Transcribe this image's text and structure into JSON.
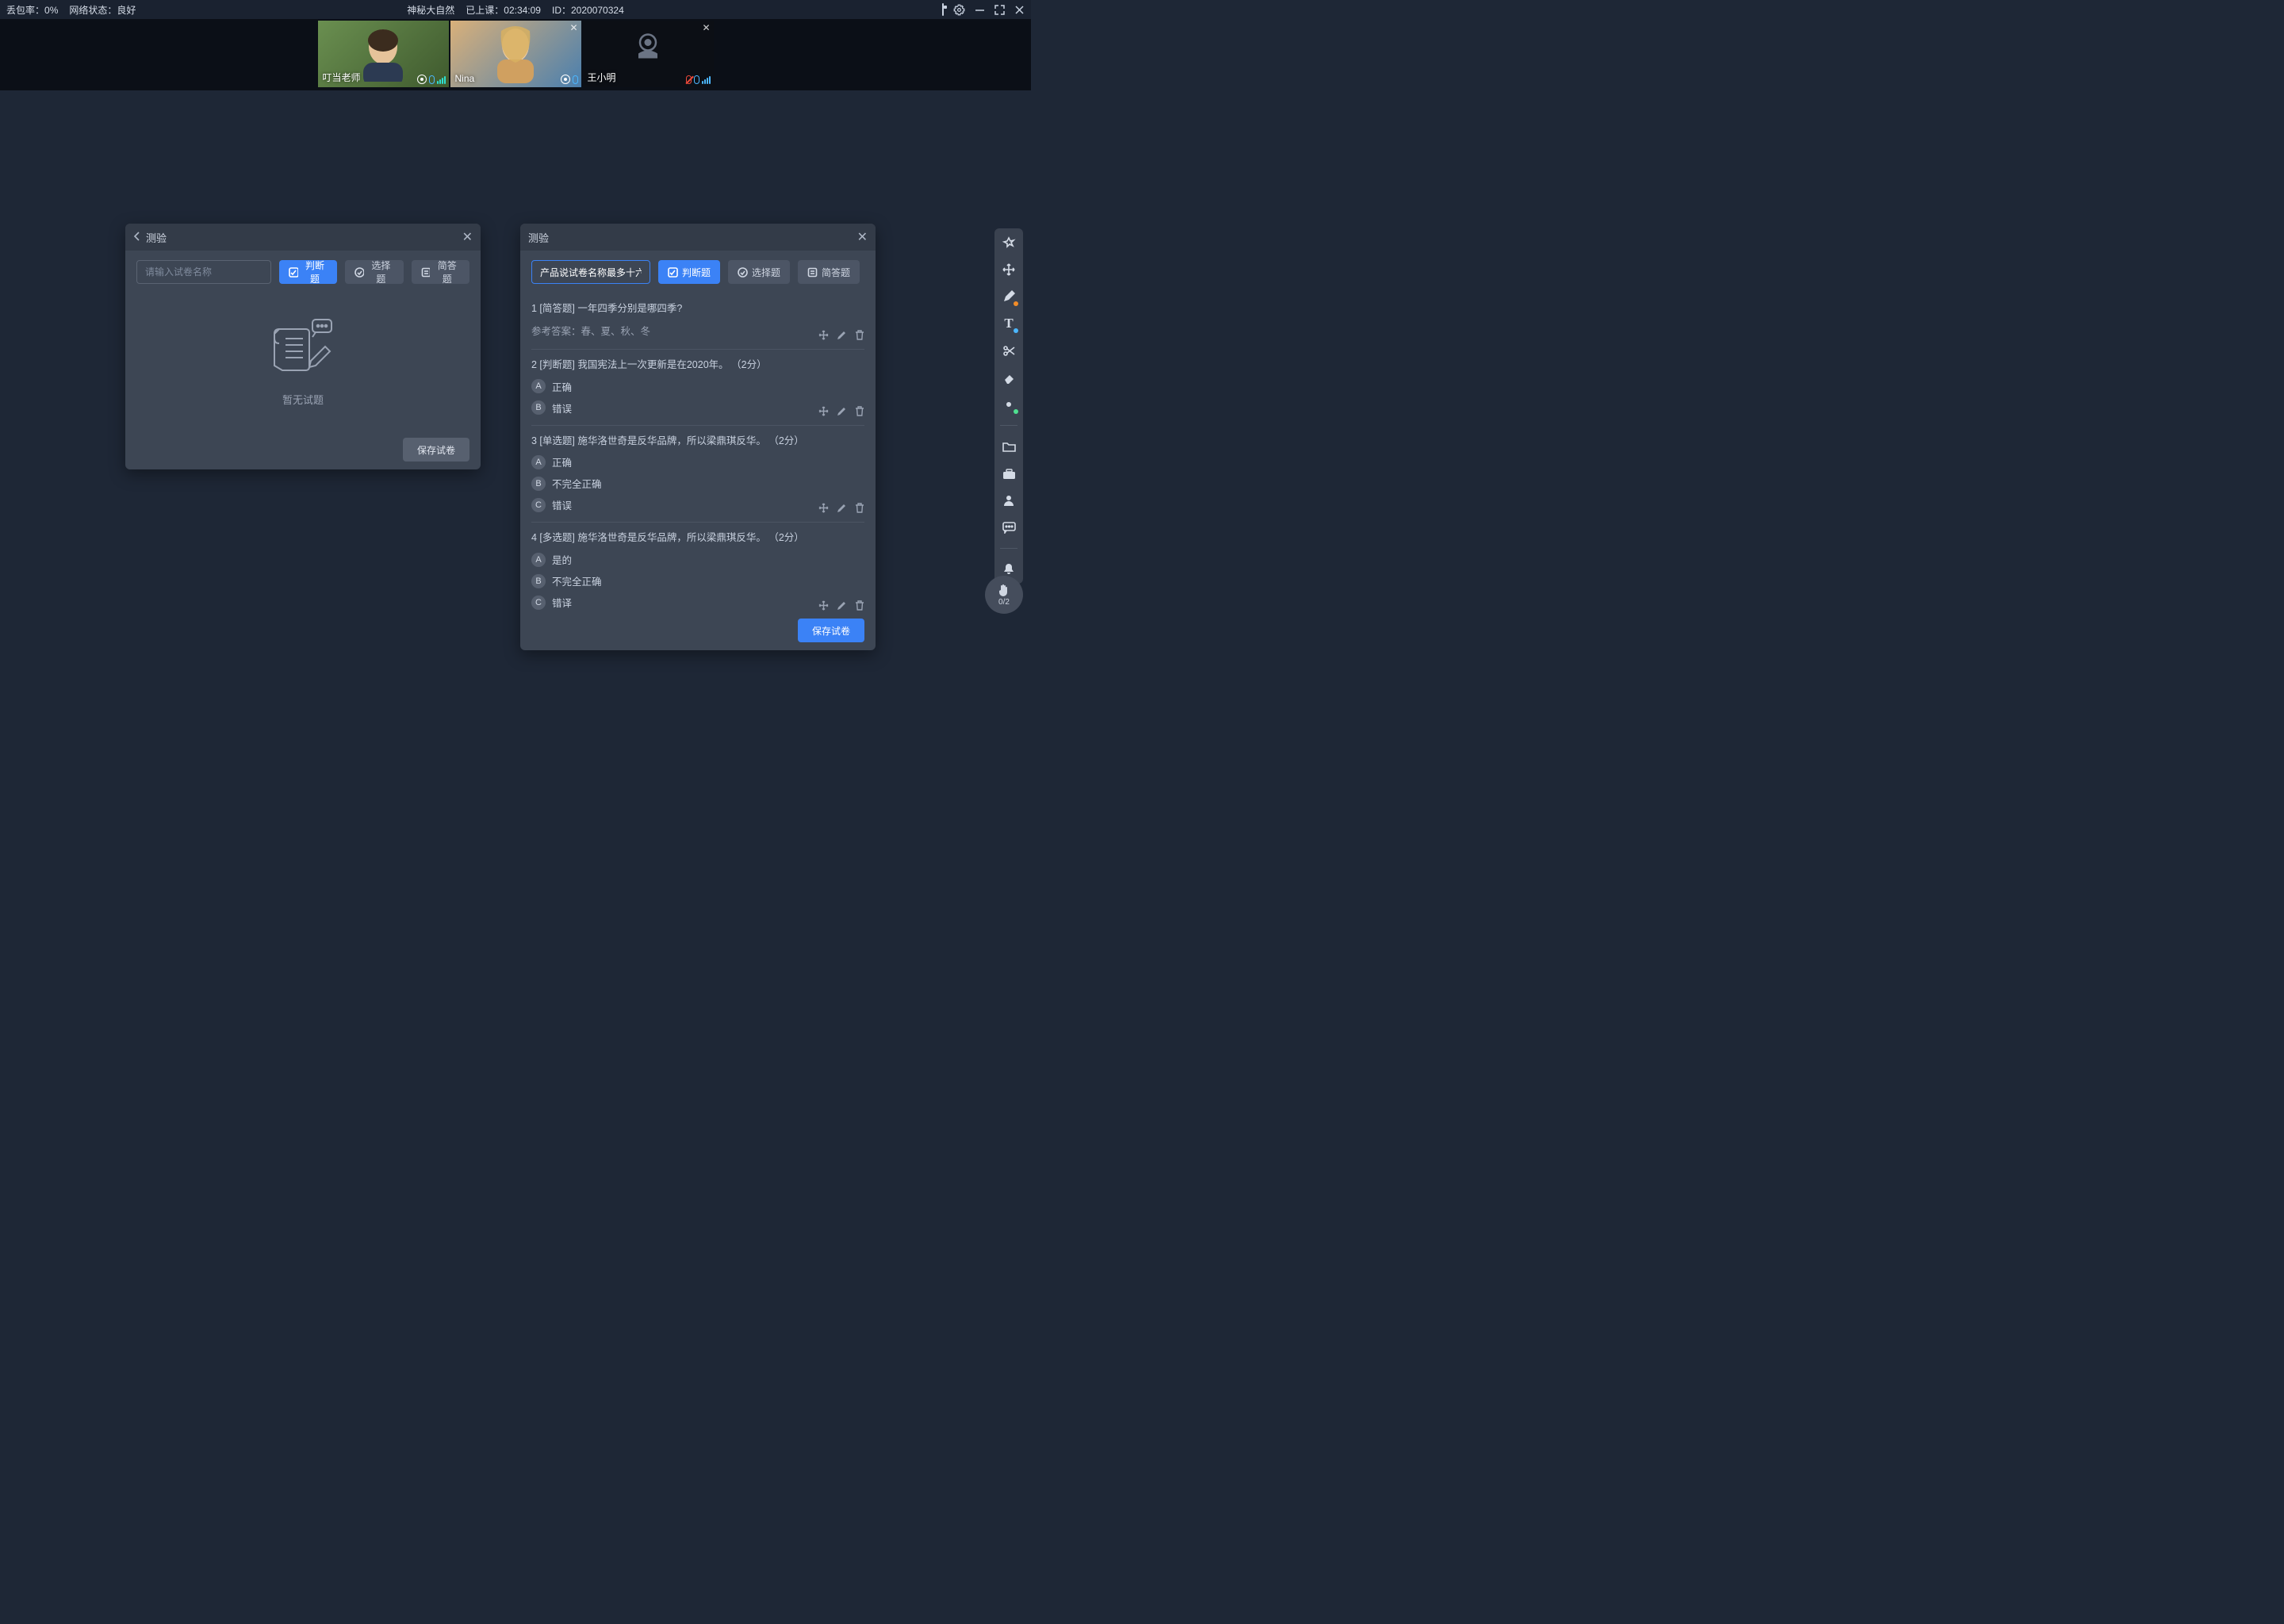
{
  "topbar": {
    "packet_loss_label": "丢包率：",
    "packet_loss_value": "0%",
    "net_label": "网络状态：",
    "net_value": "良好",
    "course_title": "神秘大自然",
    "elapsed_label": "已上课：",
    "elapsed_value": "02:34:09",
    "id_label": "ID：",
    "id_value": "2020070324"
  },
  "videos": {
    "tiles": [
      {
        "name": "叮当老师",
        "closable": false,
        "mic_on": true,
        "cam_off": false
      },
      {
        "name": "Nina",
        "closable": true,
        "mic_on": true,
        "cam_off": false
      },
      {
        "name": "王小明",
        "closable": true,
        "mic_on": false,
        "cam_off": true
      }
    ]
  },
  "panel_left": {
    "title": "测验",
    "name_placeholder": "请输入试卷名称",
    "btn_judge": "判断题",
    "btn_choice": "选择题",
    "btn_short": "简答题",
    "empty_text": "暂无试题",
    "save_label": "保存试卷"
  },
  "panel_right": {
    "title": "测验",
    "name_value": "产品说试卷名称最多十六个字",
    "btn_judge": "判断题",
    "btn_choice": "选择题",
    "btn_short": "简答题",
    "answer_prefix": "参考答案：",
    "save_label": "保存试卷",
    "questions": [
      {
        "num": 1,
        "type": "简答题",
        "points": "",
        "text": "一年四季分别是哪四季?",
        "answer": "春、夏、秋、冬",
        "options": []
      },
      {
        "num": 2,
        "type": "判断题",
        "points": "（2分）",
        "text": "我国宪法上一次更新是在2020年。",
        "options": [
          {
            "badge": "A",
            "label": "正确"
          },
          {
            "badge": "B",
            "label": "错误"
          }
        ]
      },
      {
        "num": 3,
        "type": "单选题",
        "points": "（2分）",
        "text": "施华洛世奇是反华品牌，所以梁鼎琪反华。",
        "options": [
          {
            "badge": "A",
            "label": "正确"
          },
          {
            "badge": "B",
            "label": "不完全正确"
          },
          {
            "badge": "C",
            "label": "错误"
          }
        ]
      },
      {
        "num": 4,
        "type": "多选题",
        "points": "（2分）",
        "text": "施华洛世奇是反华品牌，所以梁鼎琪反华。",
        "options": [
          {
            "badge": "A",
            "label": "是的"
          },
          {
            "badge": "B",
            "label": "不完全正确"
          },
          {
            "badge": "C",
            "label": "错译"
          }
        ]
      }
    ]
  },
  "hand": {
    "count": "0/2"
  }
}
